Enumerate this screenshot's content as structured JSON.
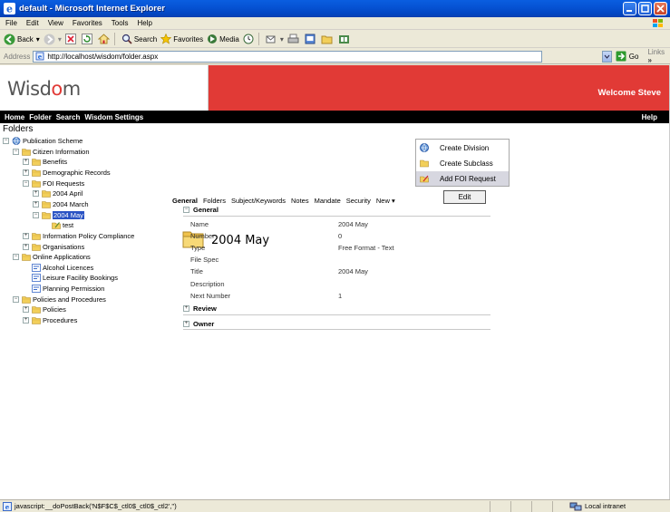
{
  "window": {
    "title": "default - Microsoft Internet Explorer"
  },
  "menu": [
    "File",
    "Edit",
    "View",
    "Favorites",
    "Tools",
    "Help"
  ],
  "toolbar": {
    "back": "Back",
    "search": "Search",
    "favorites": "Favorites",
    "media": "Media"
  },
  "address": {
    "label": "Address",
    "url": "http://localhost/wisdom/folder.aspx",
    "go": "Go",
    "links": "Links"
  },
  "site": {
    "logo_pre": "Wisd",
    "logo_o": "o",
    "logo_post": "m",
    "welcome": "Welcome Steve",
    "nav": [
      "Home",
      "Folder",
      "Search",
      "Wisdom Settings"
    ],
    "help": "Help"
  },
  "tree": {
    "header": "Folders",
    "nodes": [
      {
        "label": "Publication Scheme",
        "indent": 0,
        "toggle": "−",
        "icon": "globe"
      },
      {
        "label": "Citizen Information",
        "indent": 1,
        "toggle": "−",
        "icon": "folder"
      },
      {
        "label": "Benefits",
        "indent": 2,
        "toggle": "+",
        "icon": "folder"
      },
      {
        "label": "Demographic Records",
        "indent": 2,
        "toggle": "+",
        "icon": "folder"
      },
      {
        "label": "FOI Requests",
        "indent": 2,
        "toggle": "−",
        "icon": "folder"
      },
      {
        "label": "2004 April",
        "indent": 3,
        "toggle": "+",
        "icon": "folder"
      },
      {
        "label": "2004 March",
        "indent": 3,
        "toggle": "+",
        "icon": "folder"
      },
      {
        "label": "2004 May",
        "indent": 3,
        "toggle": "−",
        "icon": "folder",
        "selected": true
      },
      {
        "label": "test",
        "indent": 4,
        "toggle": "",
        "icon": "doc"
      },
      {
        "label": "Information Policy Compliance",
        "indent": 2,
        "toggle": "+",
        "icon": "folder"
      },
      {
        "label": "Organisations",
        "indent": 2,
        "toggle": "+",
        "icon": "folder"
      },
      {
        "label": "Online Applications",
        "indent": 1,
        "toggle": "−",
        "icon": "folder"
      },
      {
        "label": "Alcohol Licences",
        "indent": 2,
        "toggle": "",
        "icon": "form"
      },
      {
        "label": "Leisure Facility Bookings",
        "indent": 2,
        "toggle": "",
        "icon": "form"
      },
      {
        "label": "Planning Permission",
        "indent": 2,
        "toggle": "",
        "icon": "form"
      },
      {
        "label": "Policies and Procedures",
        "indent": 1,
        "toggle": "−",
        "icon": "folder"
      },
      {
        "label": "Policies",
        "indent": 2,
        "toggle": "+",
        "icon": "folder"
      },
      {
        "label": "Procedures",
        "indent": 2,
        "toggle": "+",
        "icon": "folder"
      }
    ]
  },
  "tabs": [
    "General",
    "Folders",
    "Subject/Keywords",
    "Notes",
    "Mandate",
    "Security",
    "New ▾"
  ],
  "new_menu": [
    "Create Division",
    "Create Subclass",
    "Add FOI Request"
  ],
  "edit_label": "Edit",
  "doc_title": "2004 May",
  "sections": {
    "general": "General",
    "review": "Review",
    "owner": "Owner"
  },
  "fields": [
    {
      "label": "Name",
      "value": "2004 May"
    },
    {
      "label": "Number",
      "value": "0"
    },
    {
      "label": "Type",
      "value": "Free Format - Text"
    },
    {
      "label": "File Spec",
      "value": ""
    },
    {
      "label": "Title",
      "value": "2004 May"
    },
    {
      "label": "Description",
      "value": ""
    },
    {
      "label": "Next Number",
      "value": "1"
    }
  ],
  "status": {
    "text": "javascript:__doPostBack('N$F$C$_ctl0$_ctl0$_ctl2','')",
    "zone": "Local intranet"
  },
  "colors": {
    "banner": "#e13a36",
    "navbar": "#000000",
    "selection": "#2a53c4"
  }
}
